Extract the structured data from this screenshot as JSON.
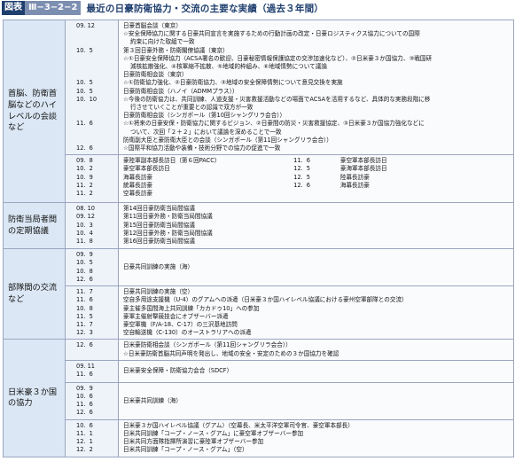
{
  "figure": {
    "label": "図表",
    "number": "Ⅲ−3−2−2",
    "title": "最近の日豪防衛協力・交流の主要な実績（過去３年間）"
  },
  "sections": [
    {
      "category": "首脳、防衛首脳などのハイレベルの会談など",
      "block1": {
        "dates": "09. 12\n\n\n10.  5\n\n\n\n10.  5\n10.  5\n10.  10\n\n\n11.  6\n\n\n12.  6",
        "lines": [
          "日豪首脳会談（東京）",
          "☆安全保障協力に関する日豪共同宣言を実施するための行動計画の改定・日豪ロジスティクス協力についての国際",
          "約束に向けた取組で一致",
          "第３回日豪外務・防衛閣僚協議（東京）",
          "☆①日豪安全保障協力（ACSA署名の歓迎、日豪秘密情報保護協定の交渉加速化など）、②日米豪３か国協力、③戦国研",
          "減核拡散強化、④核軍縮不拡散、⑤地域的枠組み、⑥地域情勢について議論",
          "日豪防衛相会談（東京）",
          "☆①防衛協力強化、②日豪防衛協力、③地域の安全保障情勢について意見交換を実施",
          "日豪防衛相会談（ハノイ（ADMMプラス））",
          "☆今後の防衛協力は、共同訓練、人道支援・災害救援活動などの場面でACSAを活用するなど、具体的な実務段階に移",
          "行させていくことが重要との認識で双方が一致",
          "日豪防衛相会談（シンガポール（第10回シャングリラ会合））",
          "☆①将来の日豪安保・防衛協力に関するビジョン、②日豪間の防災・災害救援協定、③日米豪３か国協力強化などに",
          "ついて、次回「２＋２」において議論を深めることで一致",
          "防衛副大臣と豪防衛大臣との会談（シンガポール（第11回シャングリラ会合））",
          "☆国際平和協力活動や装備・技術分野での協力の促進で一致"
        ]
      },
      "block2": {
        "left_dates": "09.  8\n10.  2\n10.  9\n11.  2\n11.  2",
        "left_items": [
          "豪陸軍副本部長訪日（第６回PACC）",
          "豪空軍本部長訪日",
          "海幕長訪豪",
          "統幕長訪豪",
          "空幕長訪豪"
        ],
        "right_dates": "11.  6\n12.  5\n12.  5\n12.  6",
        "right_items": [
          "豪空軍本部長訪日",
          "豪海軍本部長訪日",
          "陸幕長訪豪",
          "海幕長訪豪"
        ]
      }
    },
    {
      "category": "防衛当局者間の定期協議",
      "dates": "08. 10\n09. 12\n10.  3\n10.  4\n11.  8",
      "lines": [
        "第14回日豪防衛当局間協議",
        "第11回日豪外務・防衛当局間協議",
        "第15回日豪防衛当局間協議",
        "第12回日豪外務・防衛当局間協議",
        "第16回日豪防衛当局間協議"
      ]
    },
    {
      "category": "部隊間の交流など",
      "block1": {
        "dates": "09.  9\n10.  5\n10.  8\n12.  6",
        "lines": [
          "日豪共同訓練の実施（海）"
        ]
      },
      "block2": {
        "dates": "11.  7\n11.  6\n10.  8\n11.  5\n11.  7\n12.  3",
        "lines": [
          "日豪共同訓練の実施（空）",
          "空自多用途支援機（U-4）のグアムへの派遣（日米豪３か国ハイレベル協議における豪州空軍部隊との交流）",
          "豪主催多国間海上共同訓練「カカドゥ10」への参加",
          "豪軍主催射撃競技会にオブザーバー派遣",
          "豪空軍機（F/A-18、C-17）の三沢基地訪問",
          "空自輸送機（C-130）のオーストラリアへの派遣"
        ]
      }
    },
    {
      "category": "日米豪３か国の協力",
      "block1": {
        "dates": "12.  6",
        "lines": [
          "日米豪防衛相会談（シンガポール（第11回シャングリラ会合））",
          "☆日米豪防衛首脳共同声明を発出し、地域の安全・安定のための３か国協力を確認"
        ]
      },
      "block2": {
        "dates": "09. 11\n11.  6",
        "lines": [
          "日米豪安全保障・防衛協力会合（SDCF）"
        ]
      },
      "block3": {
        "dates": "09.  9\n10.  6\n11.  6\n12.  6",
        "lines": [
          "日米豪共同訓練（海）"
        ]
      },
      "block4": {
        "dates": "10.  6\n11.  1\n12.  1\n12.  2",
        "lines": [
          "日米豪３か国ハイレベル協議（グアム）（空幕長、米太平洋空軍司令官、豪空軍本部長）",
          "日米共同訓練「コープ・ノース・グアム」に豪空軍オブザーバー参加",
          "日米共同方面隊指揮所演習に豪陸軍オブザーバー参加",
          "日米共同訓練「コープ・ノース・グアム」（空）"
        ]
      }
    }
  ]
}
